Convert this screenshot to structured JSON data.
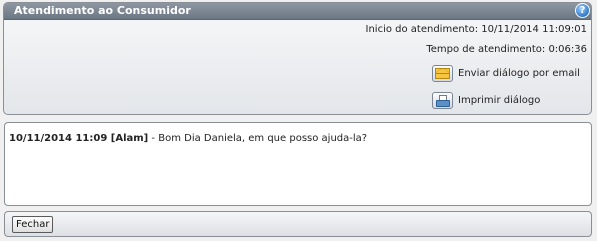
{
  "window": {
    "title": "Atendimento ao Consumidor",
    "help_icon": "help-globe-icon"
  },
  "info": {
    "start_label": "Inicio do atendimento: 10/11/2014 11:09:01",
    "duration_label": "Tempo de atendimento: 0:06:36"
  },
  "actions": {
    "email": {
      "label": "Enviar diálogo por email",
      "icon": "envelope-icon"
    },
    "print": {
      "label": "Imprimir diálogo",
      "icon": "printer-icon"
    }
  },
  "chat": {
    "messages": [
      {
        "meta": "10/11/2014 11:09 [Alam]",
        "separator": " - ",
        "text": "Bom Dia Daniela, em que posso ajuda-la?"
      }
    ]
  },
  "footer": {
    "close_label": "Fechar"
  }
}
